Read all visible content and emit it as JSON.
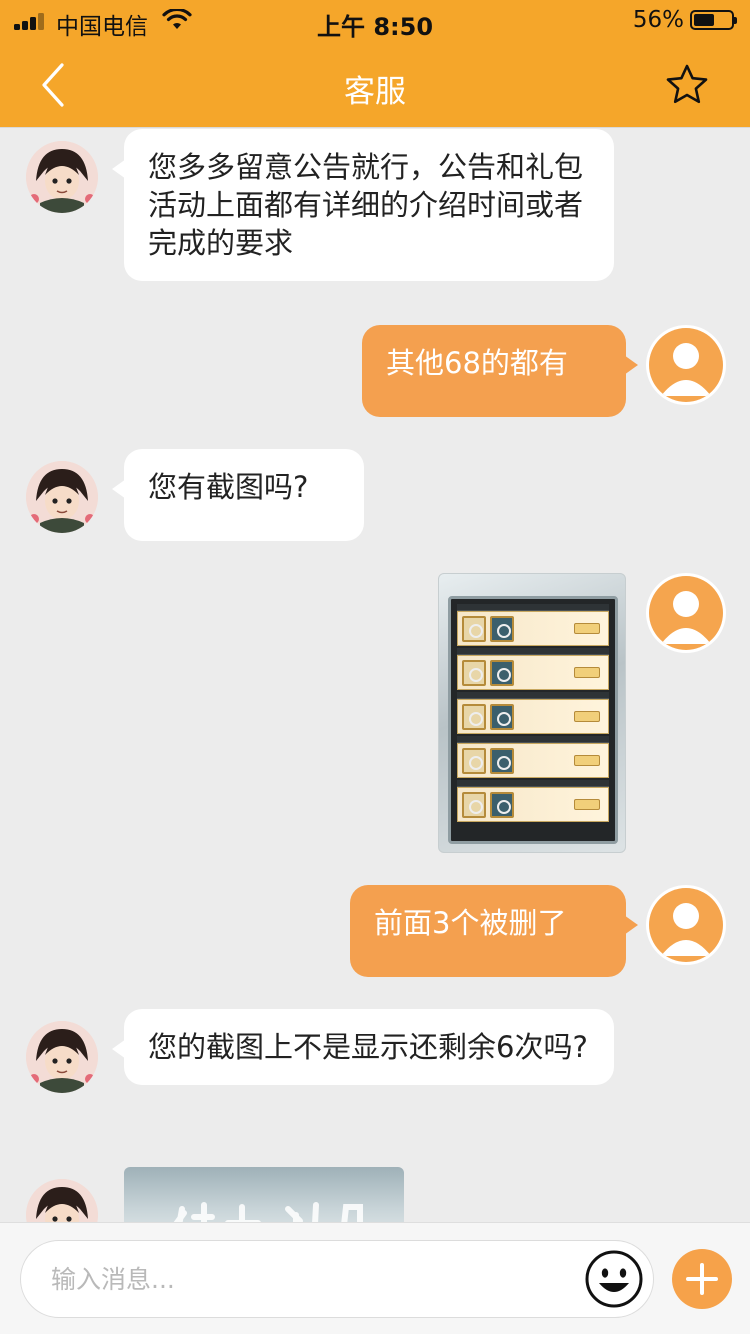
{
  "status_bar": {
    "carrier": "中国电信",
    "time": "上午 8:50",
    "battery": "56%",
    "battery_level": 0.56
  },
  "nav": {
    "title": "客服"
  },
  "messages": [
    {
      "from": "agent",
      "text": "您多多留意公告就行，公告和礼包活动上面都有详细的介绍时间或者完成的要求"
    },
    {
      "from": "user",
      "text": "其他68的都有"
    },
    {
      "from": "agent",
      "text": "您有截图吗?"
    },
    {
      "from": "user",
      "type": "image"
    },
    {
      "from": "user",
      "text": "前面3个被删了"
    },
    {
      "from": "agent",
      "text": "您的截图上不是显示还剩余6次吗?"
    },
    {
      "from": "agent",
      "type": "image"
    }
  ],
  "input": {
    "placeholder": "输入消息..."
  },
  "colors": {
    "header": "#f5a62a",
    "bubble_out": "#f4a04f",
    "background": "#ececec"
  },
  "icons": [
    "back-icon",
    "star-icon",
    "wifi-icon",
    "emoji-icon",
    "plus-icon"
  ]
}
